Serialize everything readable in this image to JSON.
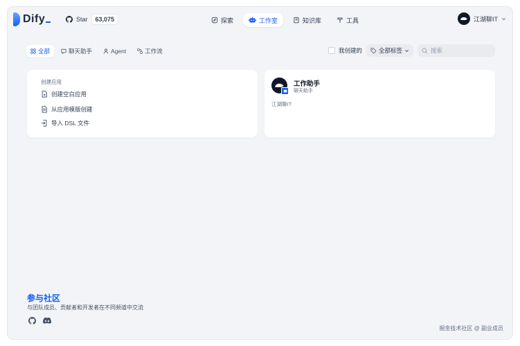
{
  "brand": {
    "name": "Dify"
  },
  "github": {
    "star_label": "Star",
    "count": "63,075"
  },
  "nav": [
    {
      "label": "探索",
      "icon": "compass-icon"
    },
    {
      "label": "工作室",
      "icon": "robot-icon",
      "active": true
    },
    {
      "label": "知识库",
      "icon": "book-icon"
    },
    {
      "label": "工具",
      "icon": "hammer-icon"
    }
  ],
  "user": {
    "name": "江湖聊IT"
  },
  "filters": {
    "tabs": [
      {
        "label": "全部",
        "icon": "grid-icon",
        "active": true
      },
      {
        "label": "聊天助手",
        "icon": "chat-icon"
      },
      {
        "label": "Agent",
        "icon": "agent-icon"
      },
      {
        "label": "工作流",
        "icon": "workflow-icon"
      }
    ],
    "my_created_label": "我创建的",
    "my_created_checked": false,
    "tag_filter_label": "全部标签",
    "search_placeholder": "搜索"
  },
  "create": {
    "title": "创建应用",
    "items": [
      {
        "label": "创建空白应用",
        "icon": "file-plus-icon"
      },
      {
        "label": "从应用模版创建",
        "icon": "template-icon"
      },
      {
        "label": "导入 DSL 文件",
        "icon": "import-icon"
      }
    ]
  },
  "app_card": {
    "name": "工作助手",
    "type": "聊天助手",
    "description": "江湖聊IT",
    "badge_color": "#155eef"
  },
  "community": {
    "title": "参与社区",
    "description": "与团队成员、贡献者和开发者在不同频道中交流",
    "icons": [
      "github-icon",
      "discord-icon"
    ]
  },
  "watermark": "掘金技术社区 @ 副业成员",
  "colors": {
    "accent": "#155eef",
    "background": "#f2f4f7",
    "text": "#344054"
  }
}
